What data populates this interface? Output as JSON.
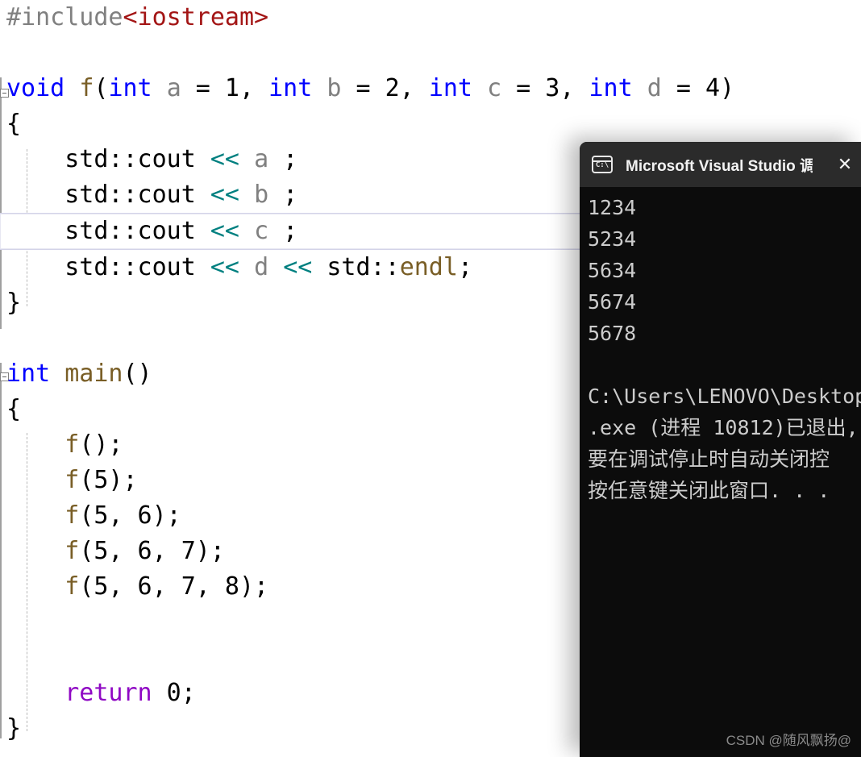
{
  "editor": {
    "language": "cpp",
    "background": "#ffffff",
    "current_line_index": 5,
    "colors": {
      "preprocessor": "#808080",
      "string_include": "#a31515",
      "keyword": "#0000ff",
      "keyword_control": "#8f08c4",
      "function": "#795e26",
      "variable": "#808080",
      "operator": "#008080",
      "plain": "#000000",
      "current_line_border": "#d3d3e8"
    },
    "lines": [
      {
        "id": 1,
        "tokens": [
          {
            "t": "#include",
            "c": "tok-pre"
          },
          {
            "t": "<iostream>",
            "c": "tok-str"
          }
        ]
      },
      {
        "id": 2,
        "tokens": [
          {
            "t": "",
            "c": "tok-plain"
          }
        ]
      },
      {
        "id": 3,
        "tokens": [
          {
            "t": "void",
            "c": "tok-kw"
          },
          {
            "t": " ",
            "c": "tok-plain"
          },
          {
            "t": "f",
            "c": "tok-fn"
          },
          {
            "t": "(",
            "c": "tok-plain"
          },
          {
            "t": "int",
            "c": "tok-kw"
          },
          {
            "t": " ",
            "c": "tok-plain"
          },
          {
            "t": "a",
            "c": "tok-var"
          },
          {
            "t": " = 1, ",
            "c": "tok-plain"
          },
          {
            "t": "int",
            "c": "tok-kw"
          },
          {
            "t": " ",
            "c": "tok-plain"
          },
          {
            "t": "b",
            "c": "tok-var"
          },
          {
            "t": " = 2, ",
            "c": "tok-plain"
          },
          {
            "t": "int",
            "c": "tok-kw"
          },
          {
            "t": " ",
            "c": "tok-plain"
          },
          {
            "t": "c",
            "c": "tok-var"
          },
          {
            "t": " = 3, ",
            "c": "tok-plain"
          },
          {
            "t": "int",
            "c": "tok-kw"
          },
          {
            "t": " ",
            "c": "tok-plain"
          },
          {
            "t": "d",
            "c": "tok-var"
          },
          {
            "t": " = 4)",
            "c": "tok-plain"
          }
        ]
      },
      {
        "id": 4,
        "tokens": [
          {
            "t": "{",
            "c": "tok-plain"
          }
        ]
      },
      {
        "id": 5,
        "tokens": [
          {
            "t": "    std::cout ",
            "c": "tok-plain"
          },
          {
            "t": "<<",
            "c": "tok-op"
          },
          {
            "t": " ",
            "c": "tok-plain"
          },
          {
            "t": "a",
            "c": "tok-var"
          },
          {
            "t": " ;",
            "c": "tok-plain"
          }
        ]
      },
      {
        "id": 6,
        "tokens": [
          {
            "t": "    std::cout ",
            "c": "tok-plain"
          },
          {
            "t": "<<",
            "c": "tok-op"
          },
          {
            "t": " ",
            "c": "tok-plain"
          },
          {
            "t": "b",
            "c": "tok-var"
          },
          {
            "t": " ;",
            "c": "tok-plain"
          }
        ]
      },
      {
        "id": 7,
        "tokens": [
          {
            "t": "    std::cout ",
            "c": "tok-plain"
          },
          {
            "t": "<<",
            "c": "tok-op"
          },
          {
            "t": " ",
            "c": "tok-plain"
          },
          {
            "t": "c",
            "c": "tok-var"
          },
          {
            "t": " ;",
            "c": "tok-plain"
          }
        ],
        "current": true
      },
      {
        "id": 8,
        "tokens": [
          {
            "t": "    std::cout ",
            "c": "tok-plain"
          },
          {
            "t": "<<",
            "c": "tok-op"
          },
          {
            "t": " ",
            "c": "tok-plain"
          },
          {
            "t": "d",
            "c": "tok-var"
          },
          {
            "t": " ",
            "c": "tok-plain"
          },
          {
            "t": "<<",
            "c": "tok-op"
          },
          {
            "t": " std::",
            "c": "tok-plain"
          },
          {
            "t": "endl",
            "c": "tok-macro"
          },
          {
            "t": ";",
            "c": "tok-plain"
          }
        ]
      },
      {
        "id": 9,
        "tokens": [
          {
            "t": "}",
            "c": "tok-plain"
          }
        ]
      },
      {
        "id": 10,
        "tokens": [
          {
            "t": "",
            "c": "tok-plain"
          }
        ]
      },
      {
        "id": 11,
        "tokens": [
          {
            "t": "int",
            "c": "tok-kw"
          },
          {
            "t": " ",
            "c": "tok-plain"
          },
          {
            "t": "main",
            "c": "tok-fn"
          },
          {
            "t": "()",
            "c": "tok-plain"
          }
        ]
      },
      {
        "id": 12,
        "tokens": [
          {
            "t": "{",
            "c": "tok-plain"
          }
        ]
      },
      {
        "id": 13,
        "tokens": [
          {
            "t": "    ",
            "c": "tok-plain"
          },
          {
            "t": "f",
            "c": "tok-fn"
          },
          {
            "t": "();",
            "c": "tok-plain"
          }
        ]
      },
      {
        "id": 14,
        "tokens": [
          {
            "t": "    ",
            "c": "tok-plain"
          },
          {
            "t": "f",
            "c": "tok-fn"
          },
          {
            "t": "(5);",
            "c": "tok-plain"
          }
        ]
      },
      {
        "id": 15,
        "tokens": [
          {
            "t": "    ",
            "c": "tok-plain"
          },
          {
            "t": "f",
            "c": "tok-fn"
          },
          {
            "t": "(5, 6);",
            "c": "tok-plain"
          }
        ]
      },
      {
        "id": 16,
        "tokens": [
          {
            "t": "    ",
            "c": "tok-plain"
          },
          {
            "t": "f",
            "c": "tok-fn"
          },
          {
            "t": "(5, 6, 7);",
            "c": "tok-plain"
          }
        ]
      },
      {
        "id": 17,
        "tokens": [
          {
            "t": "    ",
            "c": "tok-plain"
          },
          {
            "t": "f",
            "c": "tok-fn"
          },
          {
            "t": "(5, 6, 7, 8);",
            "c": "tok-plain"
          }
        ]
      },
      {
        "id": 18,
        "tokens": [
          {
            "t": "",
            "c": "tok-plain"
          }
        ]
      },
      {
        "id": 19,
        "tokens": [
          {
            "t": "",
            "c": "tok-plain"
          }
        ]
      },
      {
        "id": 20,
        "tokens": [
          {
            "t": "    ",
            "c": "tok-plain"
          },
          {
            "t": "return",
            "c": "tok-kw2"
          },
          {
            "t": " 0;",
            "c": "tok-plain"
          }
        ]
      },
      {
        "id": 21,
        "tokens": [
          {
            "t": "}",
            "c": "tok-plain"
          }
        ]
      }
    ]
  },
  "console": {
    "title": "Microsoft Visual Studio 调试控",
    "icon": "cmd-prompt-icon",
    "icon_label": "C:\\",
    "close_label": "✕",
    "background": "#0c0c0c",
    "titlebar_background": "#2b2b2b",
    "text_color": "#cccccc",
    "lines": [
      "1234",
      "5234",
      "5634",
      "5674",
      "5678",
      "",
      "C:\\Users\\LENOVO\\Desktop\\",
      ".exe (进程 10812)已退出,",
      "要在调试停止时自动关闭控",
      "按任意键关闭此窗口. . ."
    ]
  },
  "watermark": {
    "text": "CSDN @随风飘扬@"
  }
}
